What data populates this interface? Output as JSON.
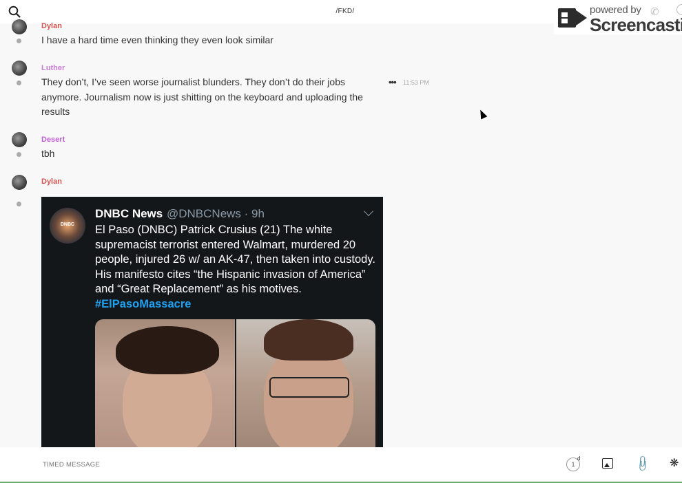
{
  "header": {
    "title": "/FKD/"
  },
  "watermark": {
    "line1": "powered by",
    "line2": "Screencastify"
  },
  "messages": [
    {
      "user": "Dylan",
      "color": "#d9534f",
      "text": "I have a hard time even thinking they even look similar"
    },
    {
      "user": "Luther",
      "color": "#c77dd4",
      "text": "They don’t, I’ve seen worse journalist blunders. They don’t do their jobs anymore. Journalism now is just shitting on the keyboard and uploading the results",
      "time": "11:53 PM"
    },
    {
      "user": "Desert",
      "color": "#c060d0",
      "text": "tbh"
    },
    {
      "user": "Dylan",
      "color": "#d9534f"
    }
  ],
  "tweet": {
    "avatar_label": "DNBC",
    "name": "DNBC News",
    "handle": "@DNBCNews · 9h",
    "body": "El Paso (DNBC) Patrick Crusius (21) The white supremacist terrorist entered Walmart, murdered 20 people, injured 26 w/ an AK-47, then taken into custody. His manifesto cites “the Hispanic invasion of America” and “Great Replacement” as his motives. ",
    "hashtag": "#ElPasoMassacre"
  },
  "composer": {
    "placeholder": "TIMED MESSAGE",
    "timer_value": "1",
    "timer_unit": "d"
  }
}
